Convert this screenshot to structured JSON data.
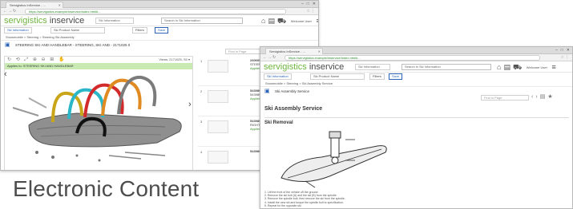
{
  "caption": "Electronic Content",
  "brand": {
    "name": "servigistics",
    "product": "inservice"
  },
  "back_window": {
    "tab_title": "Servigistics InService - ...",
    "url": "https://servigistics.example/inservice/index.html#...",
    "header": {
      "select_1": "Ski Information",
      "search_placeholder": "Search in Ski Information",
      "login": "Welcome User"
    },
    "context": "Ski Information",
    "context_field": "Ski Product Name",
    "tool_btn": "Filters",
    "save_btn": "Save",
    "breadcrumb": "Snowmobile > Steering > Steering Ski Assembly",
    "doc_title": "STEERING SKI AND HANDLEBAR - STEERING, SKI AND - 2171025 0",
    "viewer": {
      "toolbar_icons": "↻ ⟲ ⤢ ⊕ ⊖ ⊞ ✋",
      "toolbar_right": "Views: 2171025, S0 ▾",
      "green_label": "Applies to: STEERING SKI AND HANDLEBAR"
    },
    "find_placeholder": "Find in Page",
    "parts": [
      {
        "num": "1",
        "title": "2406051 STEERING ROD ASM 0",
        "sub": "STEERING, SKI AND HANDLEBAR",
        "applies": "Applies to:"
      },
      {
        "num": "2",
        "title": "5439891 STR 0",
        "sub": "5439891 STR",
        "applies": "Applies to:"
      },
      {
        "num": "3",
        "title": "5439891 Y3C 0",
        "sub": "RIGHT, BASE",
        "applies": "Applies to:"
      },
      {
        "num": "4",
        "title": "5439891 2A0 0",
        "sub": "",
        "applies": ""
      }
    ]
  },
  "front_window": {
    "tab_title": "Servigistics InService - ...",
    "url": "https://servigistics.example/inservice/index.html#...",
    "header": {
      "select_1": "Ski Information",
      "search_placeholder": "Search in Ski Information",
      "login": "Welcome User"
    },
    "context": "Ski Information",
    "context_field": "Ski Product Name",
    "tool_btn": "Filters",
    "save_btn": "Save",
    "breadcrumb": "Snowmobile > Steering > Ski Assembly Service",
    "doc_title": "Ski Assembly Service",
    "find_placeholder": "Find in Page",
    "page_title": "Ski Assembly Service",
    "section_title": "Ski Removal",
    "notes": [
      "1. Lift the front of the vehicle off the ground.",
      "2. Remove the ski bolt (A) and the ski (B) from the spindle.",
      "3. Remove the spindle bolt, then remove the ski from the spindle.",
      "4. Install the new ski and torque the spindle bolt to specification.",
      "5. Repeat for the opposite ski."
    ]
  },
  "colors": {
    "brand_green": "#6fb43f",
    "accent_blue": "#2a63b8",
    "highlight_green": "#c9ebb3"
  }
}
